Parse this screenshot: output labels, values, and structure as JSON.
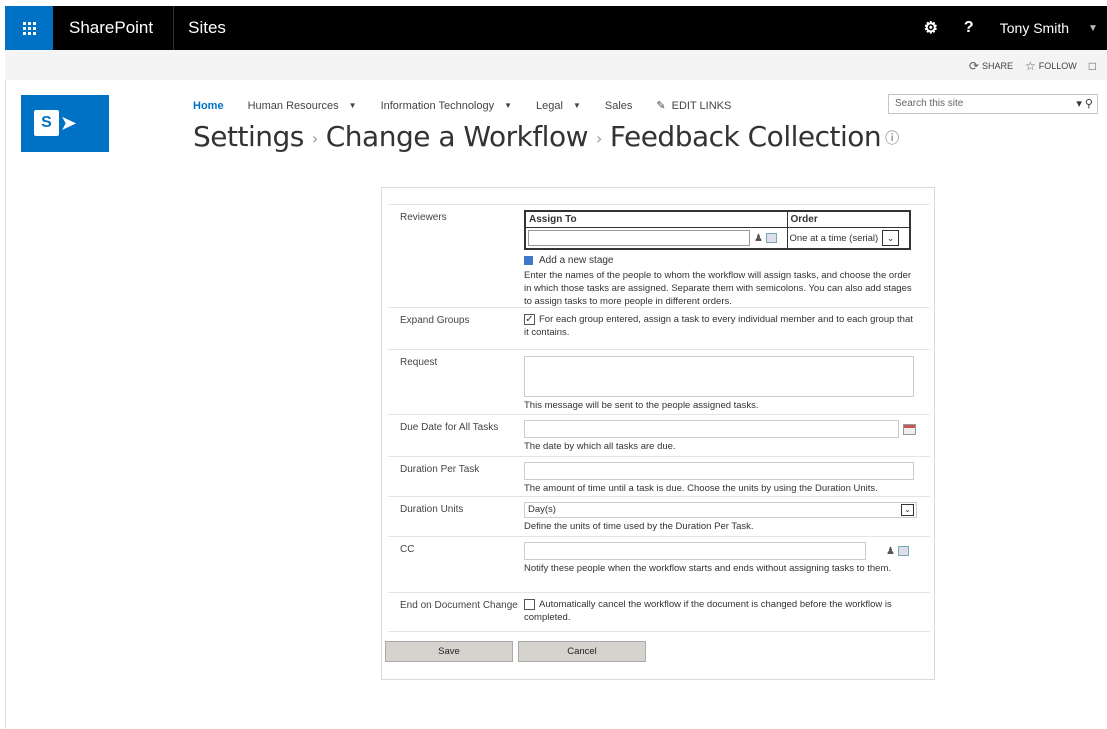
{
  "suitebar": {
    "brand": "SharePoint",
    "sites": "Sites",
    "help_label": "?",
    "user_name": "Tony Smith",
    "user_caret": "▼"
  },
  "ribbon": {
    "share_label": "SHARE",
    "follow_label": "FOLLOW"
  },
  "logo": {
    "letter": "S",
    "accent_color": "#0072c6"
  },
  "topnav": {
    "items": [
      {
        "label": "Home",
        "caret": false
      },
      {
        "label": "Human Resources",
        "caret": true
      },
      {
        "label": "Information Technology",
        "caret": true
      },
      {
        "label": "Legal",
        "caret": true
      },
      {
        "label": "Sales",
        "caret": false
      }
    ],
    "edit_links": "EDIT LINKS"
  },
  "search": {
    "placeholder": "Search this site"
  },
  "breadcrumb": {
    "part1": "Settings",
    "part2": "Change a Workflow",
    "part3": "Feedback Collection"
  },
  "form": {
    "reviewers": {
      "label": "Reviewers",
      "col_assign": "Assign To",
      "col_order": "Order",
      "order_value": "One at a time (serial)",
      "add_stage": "Add a new stage",
      "desc": "Enter the names of the people to whom the workflow will assign tasks, and choose the order in which those tasks are assigned. Separate them with semicolons. You can also add stages to assign tasks to more people in different orders."
    },
    "expand_groups": {
      "label": "Expand Groups",
      "checked": true,
      "text": "For each group entered, assign a task to every individual member and to each group that it contains."
    },
    "request": {
      "label": "Request",
      "desc": "This message will be sent to the people assigned tasks."
    },
    "due_date": {
      "label": "Due Date for All Tasks",
      "desc": "The date by which all tasks are due."
    },
    "duration": {
      "label": "Duration Per Task",
      "desc": "The amount of time until a task is due. Choose the units by using the Duration Units."
    },
    "duration_units": {
      "label": "Duration Units",
      "value": "Day(s)",
      "desc": "Define the units of time used by the Duration Per Task."
    },
    "cc": {
      "label": "CC",
      "desc": "Notify these people when the workflow starts and ends without assigning tasks to them."
    },
    "end_on_change": {
      "label": "End on Document Change",
      "checked": false,
      "text": "Automatically cancel the workflow if the document is changed before the workflow is completed."
    }
  },
  "buttons": {
    "save": "Save",
    "cancel": "Cancel"
  }
}
